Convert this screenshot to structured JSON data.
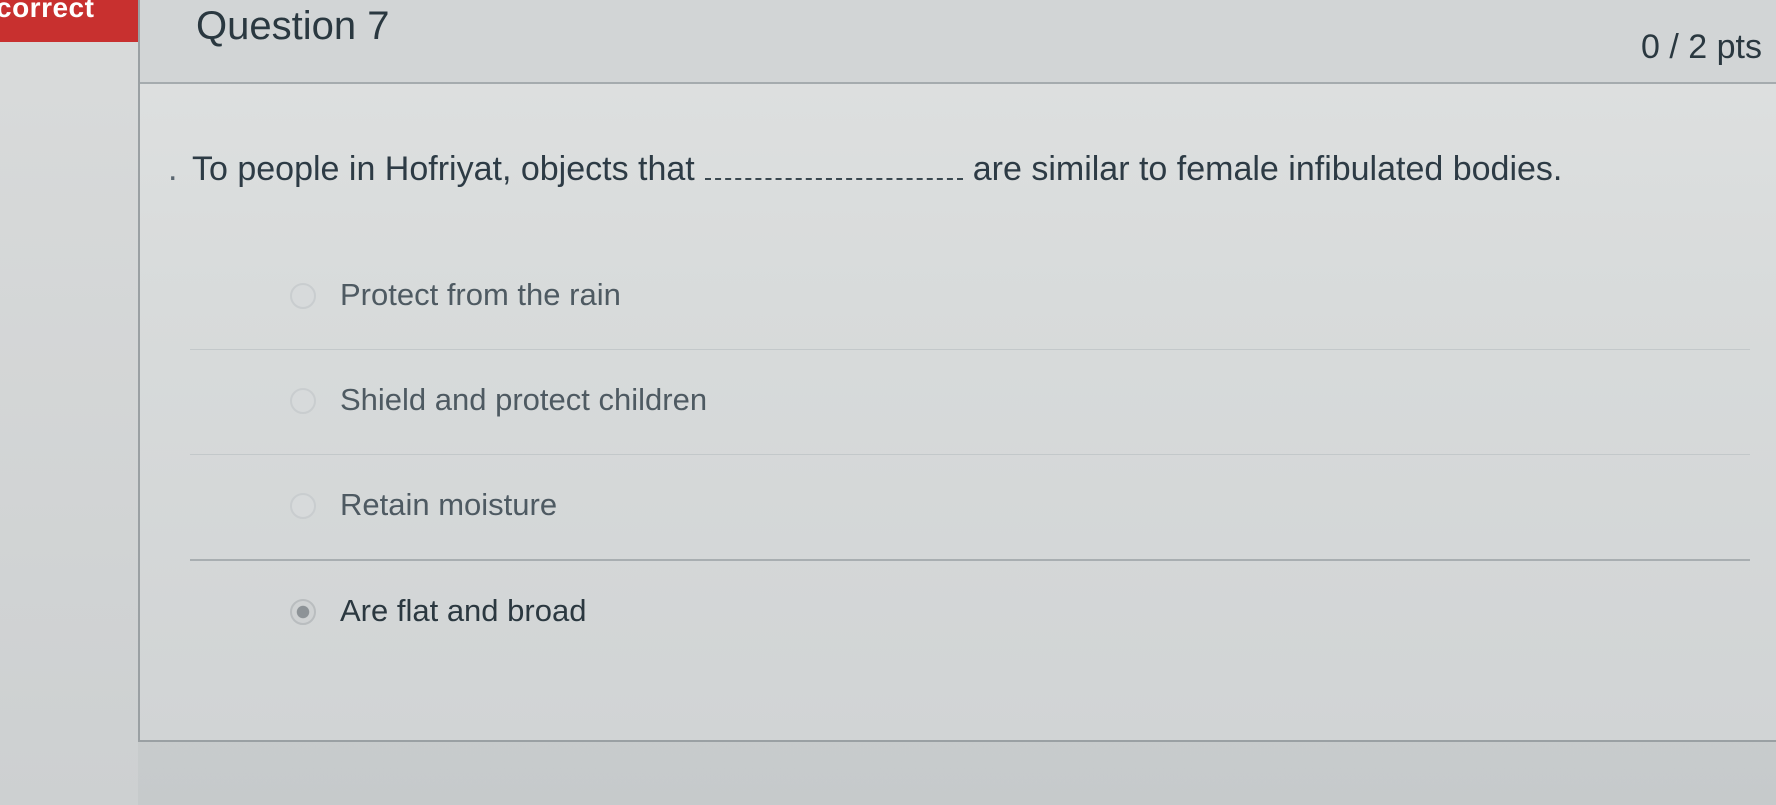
{
  "banner": {
    "label": "correct",
    "color": "#c8302f"
  },
  "question": {
    "title": "Question 7",
    "points": "0 / 2 pts",
    "text_before_blank": "To people in Hofriyat, objects that",
    "text_after_blank": "are similar to female infibulated bodies.",
    "bullet": "."
  },
  "answers": [
    {
      "label": "Protect from the rain",
      "selected": false
    },
    {
      "label": "Shield and protect children",
      "selected": false
    },
    {
      "label": "Retain moisture",
      "selected": false
    },
    {
      "label": "Are flat and broad",
      "selected": true
    }
  ]
}
